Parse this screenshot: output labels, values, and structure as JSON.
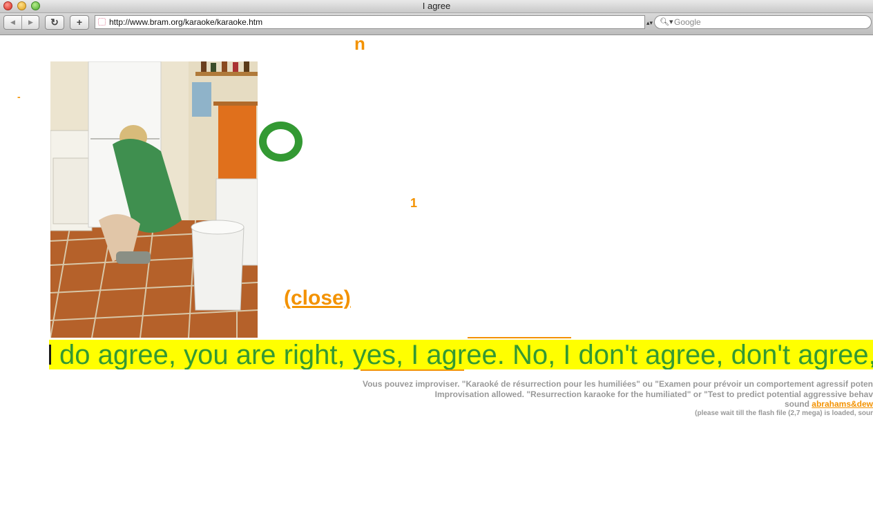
{
  "window": {
    "title": "I agree"
  },
  "toolbar": {
    "back_glyph": "◀",
    "forward_glyph": "▶",
    "reload_glyph": "↻",
    "add_glyph": "+",
    "address": "http://www.bram.org/karaoke/karaoke.htm",
    "address_menu_glyph": "▴▾",
    "search_placeholder": "Google",
    "search_glyph": "🔍︎▾"
  },
  "page": {
    "fragment_top": "n",
    "fragment_dash": "-",
    "fragment_mid": "1",
    "close_label": "(close)",
    "lyric": "do agree, you are right, yes, I agree. No, I don't agree, don't agree,",
    "caption_fr": "Vous pouvez improviser. \"Karaoké de résurrection pour les humiliées\" ou \"Examen pour prévoir un comportement agressif poten",
    "caption_en": "Improvisation allowed. \"Resurrection karaoke for the humiliated\" or \"Test to predict potential aggressive behav",
    "sound_prefix": "sound ",
    "sound_link": "abrahams&dew",
    "loading_note": "(please wait till the flash file (2,7 mega) is loaded, sour"
  },
  "colors": {
    "accent_orange": "#f39200",
    "lyric_green": "#339933",
    "lyric_background": "#ffff00",
    "caption_gray": "#999999"
  }
}
